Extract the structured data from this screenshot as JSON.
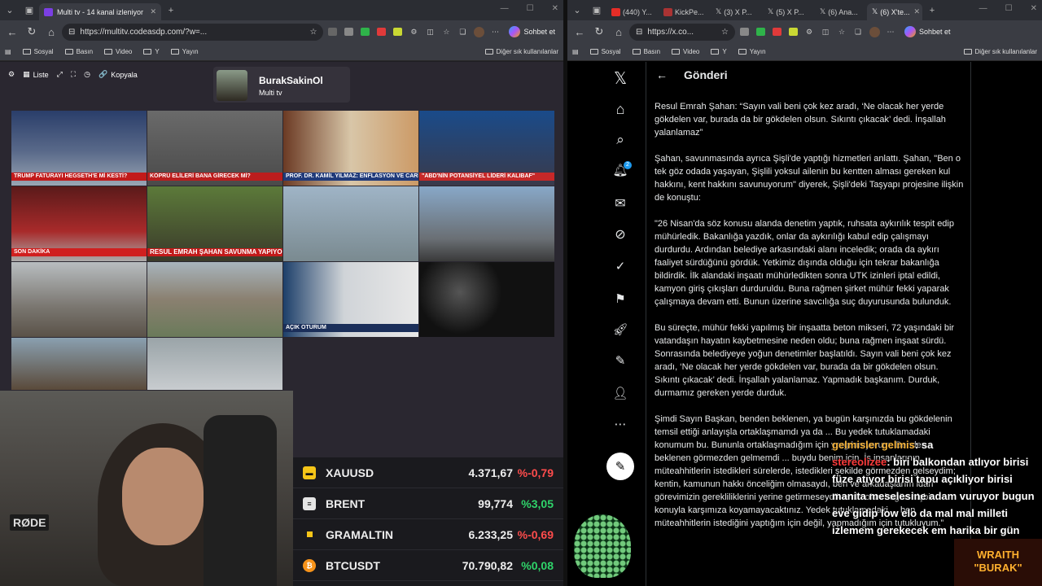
{
  "left_browser": {
    "tab_title": "Multi tv - 14 kanal izleniyor",
    "url": "https://multitv.codeasdp.com/?w=...",
    "sohbet_label": "Sohbet et",
    "bookmarks": [
      "Sosyal",
      "Basın",
      "Video",
      "Y",
      "Yayın"
    ],
    "other_bookmarks": "Diğer sık kullanılanlar"
  },
  "multitv": {
    "toolbar": {
      "liste": "Liste",
      "kopyala": "Kopyala"
    },
    "channel_name": "BurakSakinOl",
    "channel_sub": "Multi tv",
    "tickers": [
      "TRUMP FATURAYI HEGSETH'E Mİ KESTİ?",
      "KÖPRÜ ELİLERİ BANA GİRECEK Mİ?",
      "PROF. DR. KAMİL YILMAZ: ENFLASYON VE CARİ AÇIKTA",
      "\"ABD'NİN POTANSİYEL LİDERİ KALIBAF\"",
      "RESUL EMRAH ŞAHAN SAVUNMA YAPIYOR",
      "SON DAKİKA",
      "AÇIK OTURUM"
    ]
  },
  "prices": [
    {
      "symbol": "XAUUSD",
      "value": "4.371,67",
      "change": "%-0,79",
      "dir": "neg",
      "icon": "gold-bar-icon",
      "color": "#f5c518"
    },
    {
      "symbol": "BRENT",
      "value": "99,774",
      "change": "%3,05",
      "dir": "pos",
      "icon": "oil-barrel-icon",
      "color": "#e5e5e5"
    },
    {
      "symbol": "GRAMALTIN",
      "value": "6.233,25",
      "change": "%-0,69",
      "dir": "neg",
      "icon": "gold-square-icon",
      "color": "#f5c518"
    },
    {
      "symbol": "BTCUSDT",
      "value": "70.790,82",
      "change": "%0,08",
      "dir": "pos",
      "icon": "bitcoin-icon",
      "color": "#f7931a"
    }
  ],
  "webcam": {
    "mic_label": "RØDE"
  },
  "right_browser": {
    "tabs": [
      "(440) Y...",
      "KickPe...",
      "(3) X P...",
      "(5) X P...",
      "(6) Ana...",
      "(6) X'te..."
    ],
    "url": "https://x.co...",
    "sohbet_label": "Sohbet et",
    "bookmarks": [
      "Sosyal",
      "Basın",
      "Video",
      "Y",
      "Yayın"
    ],
    "other_bookmarks": "Diğer sık kullanılanlar"
  },
  "x": {
    "header": "Gönderi",
    "notif_count": "2",
    "post_paragraphs": [
      "Resul Emrah Şahan: “Sayın vali beni çok kez aradı, ‘Ne olacak her yerde gökdelen var, burada da bir gökdelen olsun. Sıkıntı çıkacak’ dedi. İnşallah yalanlamaz”",
      "Şahan, savunmasında ayrıca Şişli'de yaptığı hizmetleri anlattı. Şahan, \"Ben o tek göz odada yaşayan, Şişlili yoksul ailenin bu kentten alması gereken kul hakkını, kent hakkını savunuyorum\" diyerek, Şişli'deki Taşyapı projesine ilişkin de konuştu:",
      "\"26 Nisan'da söz konusu alanda denetim yaptık, ruhsata aykırılık tespit edip mühürledik. Bakanlığa yazdık, onlar da aykırılığı kabul edip çalışmayı durdurdu. Ardından belediye arkasındaki alanı inceledik; orada da aykırı faaliyet sürdüğünü gördük. Yetkimiz dışında olduğu için tekrar bakanlığa bildirdik. İlk alandaki inşaatı mühürledikten sonra UTK izinleri iptal edildi, kamyon giriş çıkışları durduruldu. Buna rağmen şirket mühür fekki yaparak çalışmaya devam etti. Bunun üzerine savcılığa suç duyurusunda bulunduk.",
      "Bu süreçte, mühür fekki yapılmış bir inşaatta beton mikseri, 72 yaşındaki bir vatandaşın hayatın kaybetmesine neden oldu; buna rağmen inşaat sürdü. Sonrasında belediyeye yoğun denetimler başlatıldı. Sayın vali beni çok kez aradı, ‘Ne olacak her yerde gökdelen var, burada da bir gökdelen olsun. Sıkıntı çıkacak’ dedi. İnşallah yalanlamaz. Yapmadık başkanım. Durduk, durmamız gereken yerde durduk.",
      "Şimdi Sayın Başkan, benden beklenen, ya bugün karşınızda bu gökdelenin temsil ettiği anlayışla ortaklaşmamdı ya da ... Bu yedek tutuklamadaki konumum bu. Bununla ortaklaşmadığım için yargılanıyorum. Benden beklenen görmezden gelmemdi ... buydu benim için. İş insanlarının, müteahhitlerin istedikleri sürelerde, istedikleri şekilde görmezden gelseydim; kentin, kamunun hakkı önceliğim olmasaydı, ben ve arkadaşlarım idari görevimizin gerekliliklerini yerine getirmeseydik emin olun bugün hiçbir konuyla karşımıza koyamayacaktınız. Yedek tutuklamadaki ... ben müteahhitlerin istediğini yaptığım için değil, yapmadığım için tutukluyum.”"
    ]
  },
  "chat": {
    "line1_name": "gelmisler gelmis",
    "line1_suffix": "sa",
    "line2_name": "stereolizee",
    "line2_text": "biri balkondan atlıyor birisi füze atıyor birisi tapu açıkliyor birisi manita meselesine adam vuruyor bugun eve gidip low elo da mal mal milleti izlemem gerekecek em harika bir gün"
  },
  "overlay_brand": {
    "line1": "WRAITH",
    "line2": "\"BURAK\""
  }
}
